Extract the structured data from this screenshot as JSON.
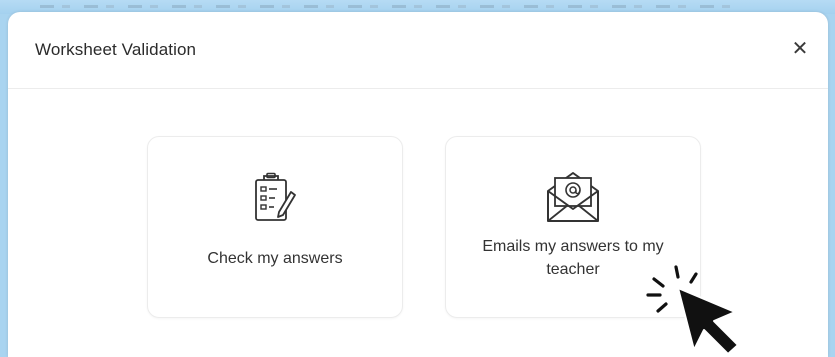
{
  "dialog": {
    "title": "Worksheet Validation",
    "close_glyph": "✕"
  },
  "options": [
    {
      "label": "Check my answers",
      "icon": "clipboard-checklist-icon"
    },
    {
      "label": "Emails my answers to my teacher",
      "icon": "email-envelope-icon"
    }
  ],
  "colors": {
    "background": "#a9d4f0",
    "dialog": "#ffffff",
    "border": "#ececec",
    "text": "#333333"
  }
}
